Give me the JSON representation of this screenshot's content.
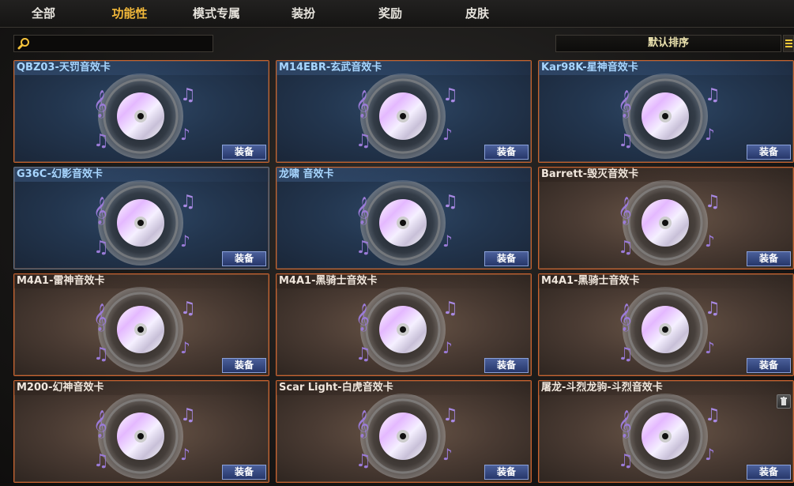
{
  "tabs": [
    {
      "label": "全部",
      "active": false
    },
    {
      "label": "功能性",
      "active": true
    },
    {
      "label": "模式专属",
      "active": false
    },
    {
      "label": "装扮",
      "active": false
    },
    {
      "label": "奖励",
      "active": false
    },
    {
      "label": "皮肤",
      "active": false
    }
  ],
  "search": {
    "value": "",
    "placeholder": ""
  },
  "sort": {
    "label": "默认排序",
    "icon": "list-icon"
  },
  "equip_label": "装备",
  "cards": [
    {
      "title": "QBZ03-天罚音效卡",
      "theme": "blue",
      "icon": "music-disc-icon"
    },
    {
      "title": "M14EBR-玄武音效卡",
      "theme": "blue",
      "icon": "music-disc-icon"
    },
    {
      "title": "Kar98K-星神音效卡",
      "theme": "blue",
      "icon": "music-disc-icon"
    },
    {
      "title": "G36C-幻影音效卡",
      "theme": "blue",
      "icon": "music-disc-icon"
    },
    {
      "title": "龙啸 音效卡",
      "theme": "blue",
      "icon": "music-disc-icon"
    },
    {
      "title": "Barrett-毁灭音效卡",
      "theme": "brown",
      "icon": "music-disc-icon"
    },
    {
      "title": "M4A1-雷神音效卡",
      "theme": "brown",
      "icon": "music-disc-icon"
    },
    {
      "title": "M4A1-黑骑士音效卡",
      "theme": "brown",
      "icon": "music-disc-icon"
    },
    {
      "title": "M4A1-黑骑士音效卡",
      "theme": "brown",
      "icon": "music-disc-icon"
    },
    {
      "title": "M200-幻神音效卡",
      "theme": "brown",
      "icon": "music-disc-icon"
    },
    {
      "title": "Scar Light-白虎音效卡",
      "theme": "brown",
      "icon": "music-disc-icon"
    },
    {
      "title": "屠龙-斗烈龙驹-斗烈音效卡",
      "theme": "brown",
      "icon": "music-disc-icon",
      "deletable": true
    }
  ],
  "colors": {
    "active_tab": "#f3b93a",
    "blue_title": "#a8d6ff",
    "card_border": "#c8602e",
    "equip_button": "#2f4380"
  }
}
